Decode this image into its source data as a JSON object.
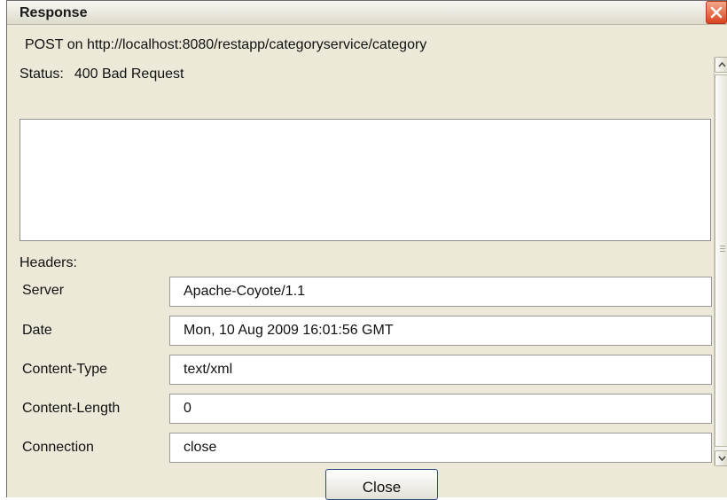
{
  "window": {
    "title": "Response"
  },
  "request": {
    "line": "POST on http://localhost:8080/restapp/categoryservice/category"
  },
  "status": {
    "label": "Status:",
    "value": "400 Bad Request"
  },
  "response_body": "",
  "headers": {
    "label": "Headers:",
    "items": [
      {
        "name": "Server",
        "value": "Apache-Coyote/1.1"
      },
      {
        "name": "Date",
        "value": "Mon, 10 Aug 2009 16:01:56 GMT"
      },
      {
        "name": "Content-Type",
        "value": "text/xml"
      },
      {
        "name": "Content-Length",
        "value": "0"
      },
      {
        "name": "Connection",
        "value": "close"
      }
    ]
  },
  "buttons": {
    "close_label": "Close"
  },
  "icons": {
    "window_close": "close-x-icon",
    "scroll_up": "arrow-up-icon",
    "scroll_down": "arrow-down-icon"
  },
  "colors": {
    "close_button_accent": "#d9441f",
    "dialog_background": "#ece9d8"
  }
}
